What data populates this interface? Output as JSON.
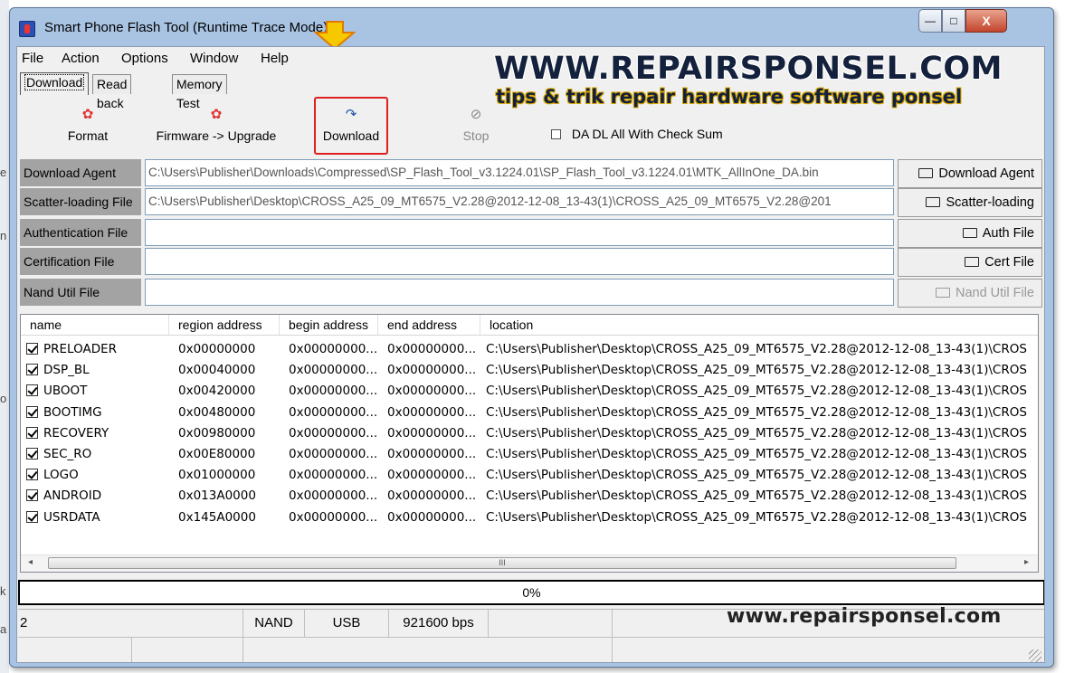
{
  "window": {
    "title": "Smart Phone Flash Tool (Runtime Trace Mode)",
    "minimize_label": "—",
    "maximize_label": "□",
    "close_label": "X"
  },
  "menu": [
    "File",
    "Action",
    "Options",
    "Window",
    "Help"
  ],
  "tabs": [
    "Download",
    "Read back",
    "Memory Test"
  ],
  "toolbar": {
    "format": "Format",
    "firmware_upgrade": "Firmware -> Upgrade",
    "download": "Download",
    "stop": "Stop",
    "da_checksum": "DA DL All With Check Sum"
  },
  "fields": [
    {
      "label": "Download Agent",
      "value": "C:\\Users\\Publisher\\Downloads\\Compressed\\SP_Flash_Tool_v3.1224.01\\SP_Flash_Tool_v3.1224.01\\MTK_AllInOne_DA.bin",
      "button": "Download Agent"
    },
    {
      "label": "Scatter-loading File",
      "value": "C:\\Users\\Publisher\\Desktop\\CROSS_A25_09_MT6575_V2.28@2012-12-08_13-43(1)\\CROSS_A25_09_MT6575_V2.28@201",
      "button": "Scatter-loading"
    },
    {
      "label": "Authentication File",
      "value": "",
      "button": "Auth File"
    },
    {
      "label": "Certification File",
      "value": "",
      "button": "Cert File"
    },
    {
      "label": "Nand Util File",
      "value": "",
      "button": "Nand Util File"
    }
  ],
  "table": {
    "columns": [
      "name",
      "region address",
      "begin address",
      "end address",
      "location"
    ],
    "rows": [
      {
        "name": "PRELOADER",
        "region": "0x00000000",
        "begin": "0x00000000...",
        "end": "0x00000000...",
        "location": "C:\\Users\\Publisher\\Desktop\\CROSS_A25_09_MT6575_V2.28@2012-12-08_13-43(1)\\CROS"
      },
      {
        "name": "DSP_BL",
        "region": "0x00040000",
        "begin": "0x00000000...",
        "end": "0x00000000...",
        "location": "C:\\Users\\Publisher\\Desktop\\CROSS_A25_09_MT6575_V2.28@2012-12-08_13-43(1)\\CROS"
      },
      {
        "name": "UBOOT",
        "region": "0x00420000",
        "begin": "0x00000000...",
        "end": "0x00000000...",
        "location": "C:\\Users\\Publisher\\Desktop\\CROSS_A25_09_MT6575_V2.28@2012-12-08_13-43(1)\\CROS"
      },
      {
        "name": "BOOTIMG",
        "region": "0x00480000",
        "begin": "0x00000000...",
        "end": "0x00000000...",
        "location": "C:\\Users\\Publisher\\Desktop\\CROSS_A25_09_MT6575_V2.28@2012-12-08_13-43(1)\\CROS"
      },
      {
        "name": "RECOVERY",
        "region": "0x00980000",
        "begin": "0x00000000...",
        "end": "0x00000000...",
        "location": "C:\\Users\\Publisher\\Desktop\\CROSS_A25_09_MT6575_V2.28@2012-12-08_13-43(1)\\CROS"
      },
      {
        "name": "SEC_RO",
        "region": "0x00E80000",
        "begin": "0x00000000...",
        "end": "0x00000000...",
        "location": "C:\\Users\\Publisher\\Desktop\\CROSS_A25_09_MT6575_V2.28@2012-12-08_13-43(1)\\CROS"
      },
      {
        "name": "LOGO",
        "region": "0x01000000",
        "begin": "0x00000000...",
        "end": "0x00000000...",
        "location": "C:\\Users\\Publisher\\Desktop\\CROSS_A25_09_MT6575_V2.28@2012-12-08_13-43(1)\\CROS"
      },
      {
        "name": "ANDROID",
        "region": "0x013A0000",
        "begin": "0x00000000...",
        "end": "0x00000000...",
        "location": "C:\\Users\\Publisher\\Desktop\\CROSS_A25_09_MT6575_V2.28@2012-12-08_13-43(1)\\CROS"
      },
      {
        "name": "USRDATA",
        "region": "0x145A0000",
        "begin": "0x00000000...",
        "end": "0x00000000...",
        "location": "C:\\Users\\Publisher\\Desktop\\CROSS_A25_09_MT6575_V2.28@2012-12-08_13-43(1)\\CROS"
      }
    ]
  },
  "scroll_label": "III",
  "progress": {
    "text": "0%",
    "value": 0
  },
  "status": {
    "com": "2",
    "storage": "NAND",
    "interface": "USB",
    "baud": "921600 bps"
  },
  "watermark": {
    "headline": "WWW.REPAIRSPONSEL.COM",
    "tagline": "tips & trik repair hardware software ponsel",
    "footer": "www.repairsponsel.com"
  },
  "background_chars": [
    "e",
    "n",
    "o",
    "k",
    "a"
  ],
  "colors": {
    "highlight": "#e0201f",
    "arrow": "#f5c800"
  }
}
